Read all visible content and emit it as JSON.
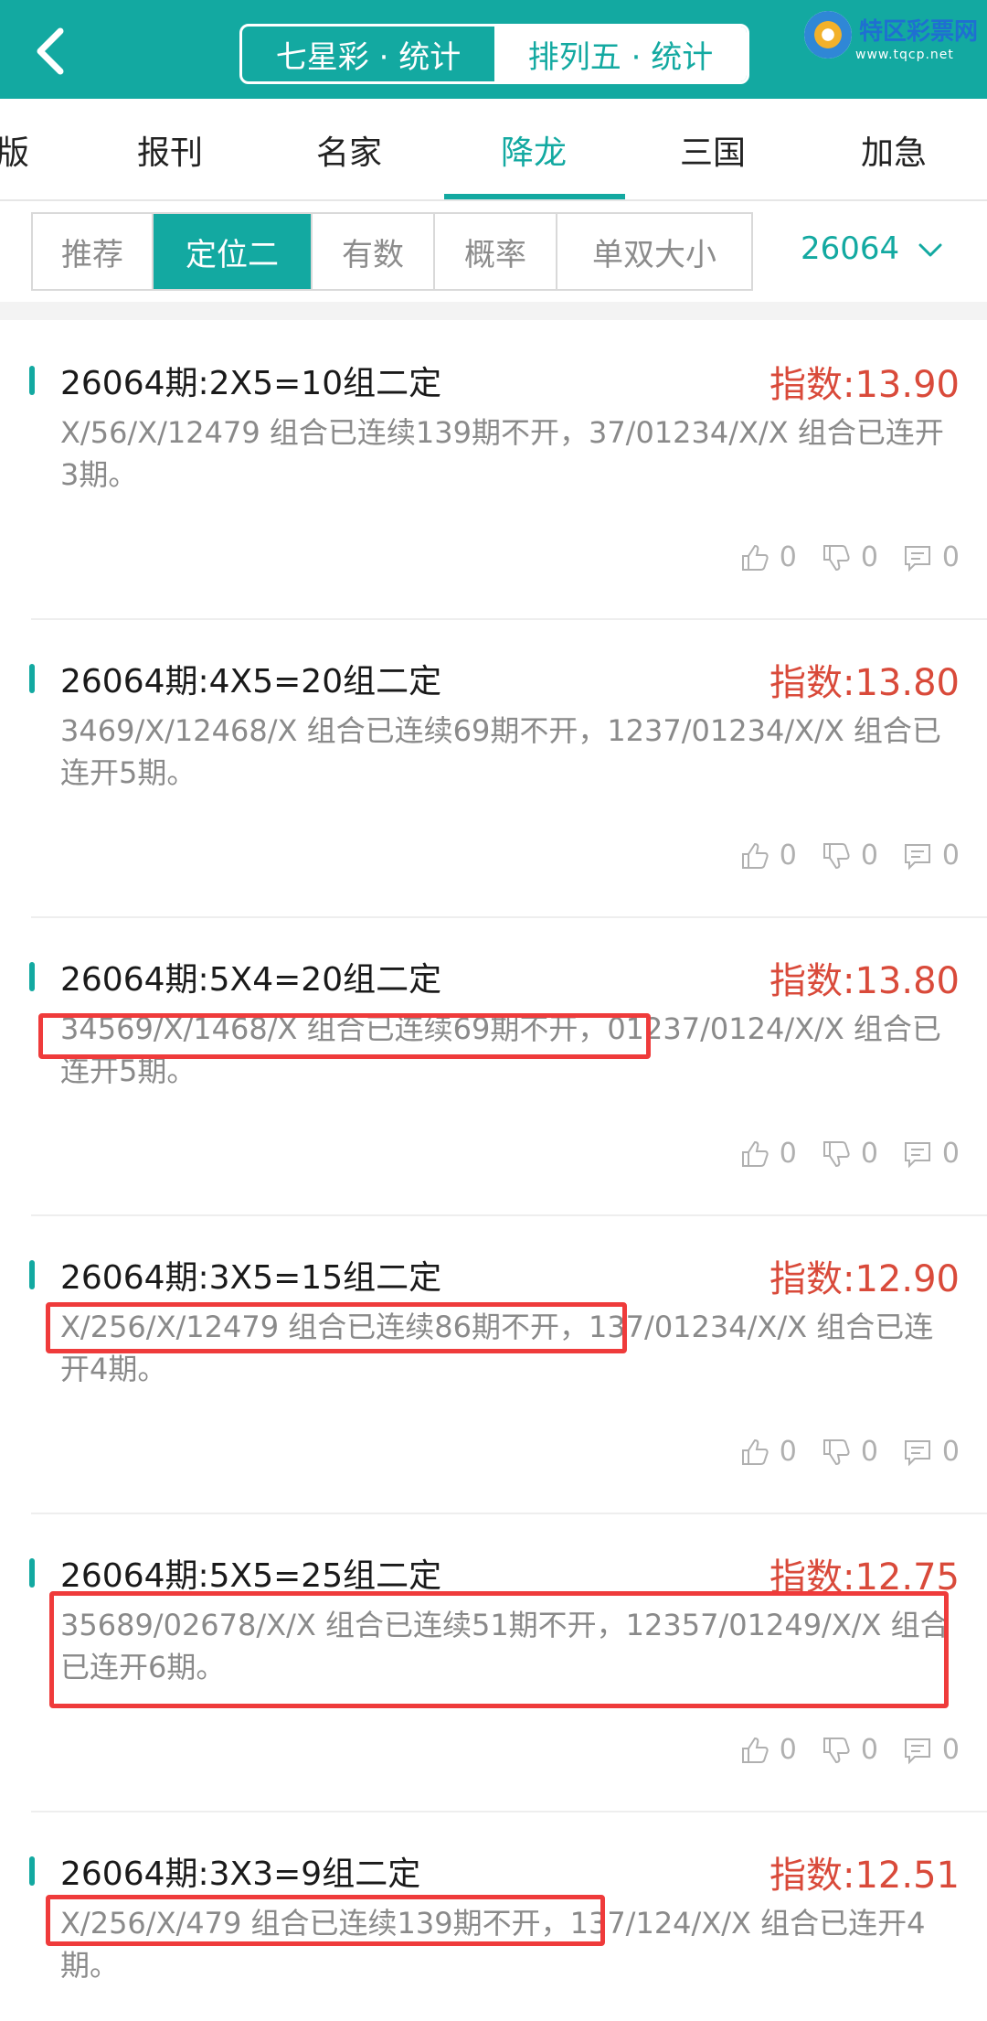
{
  "header": {
    "back_icon": "chevron-left-icon",
    "segments": [
      {
        "label": "七星彩 · 统计",
        "active": false
      },
      {
        "label": "排列五 · 统计",
        "active": true
      }
    ],
    "logo": {
      "title": "特区彩票网",
      "url": "www.tqcp.net"
    }
  },
  "tabs": {
    "items": [
      "版",
      "报刊",
      "名家",
      "降龙",
      "三国",
      "加急"
    ],
    "active": "降龙"
  },
  "filters": {
    "items": [
      "推荐",
      "定位二",
      "有数",
      "概率",
      "单双大小"
    ],
    "active": "定位二",
    "period": "26064",
    "period_icon": "chevron-down-icon"
  },
  "cards": [
    {
      "title": "26064期:2X5=10组二定",
      "index": "指数:13.90",
      "desc": "X/56/X/12479 组合已连续139期不开，37/01234/X/X 组合已连开3期。",
      "likes": "0",
      "dislikes": "0",
      "comments": "0"
    },
    {
      "title": "26064期:4X5=20组二定",
      "index": "指数:13.80",
      "desc": "3469/X/12468/X 组合已连续69期不开，1237/01234/X/X 组合已连开5期。",
      "likes": "0",
      "dislikes": "0",
      "comments": "0"
    },
    {
      "title": "26064期:5X4=20组二定",
      "index": "指数:13.80",
      "desc": "34569/X/1468/X 组合已连续69期不开，01237/0124/X/X 组合已连开5期。",
      "likes": "0",
      "dislikes": "0",
      "comments": "0"
    },
    {
      "title": "26064期:3X5=15组二定",
      "index": "指数:12.90",
      "desc": "X/256/X/12479 组合已连续86期不开，137/01234/X/X 组合已连开4期。",
      "likes": "0",
      "dislikes": "0",
      "comments": "0"
    },
    {
      "title": "26064期:5X5=25组二定",
      "index": "指数:12.75",
      "desc": "35689/02678/X/X 组合已连续51期不开，12357/01249/X/X 组合已连开6期。",
      "likes": "0",
      "dislikes": "0",
      "comments": "0"
    },
    {
      "title": "26064期:3X3=9组二定",
      "index": "指数:12.51",
      "desc": "X/256/X/479 组合已连续139期不开，137/124/X/X 组合已连开4期。",
      "likes": "0",
      "dislikes": "0",
      "comments": "0"
    }
  ],
  "icons": {
    "like": "thumbs-up-icon",
    "dislike": "thumbs-down-icon",
    "comment": "comment-icon"
  },
  "colors": {
    "accent": "#13a9a1",
    "index_red": "#d94a3a",
    "highlight": "#ef3b3b",
    "muted_text": "#8a8a8a"
  }
}
